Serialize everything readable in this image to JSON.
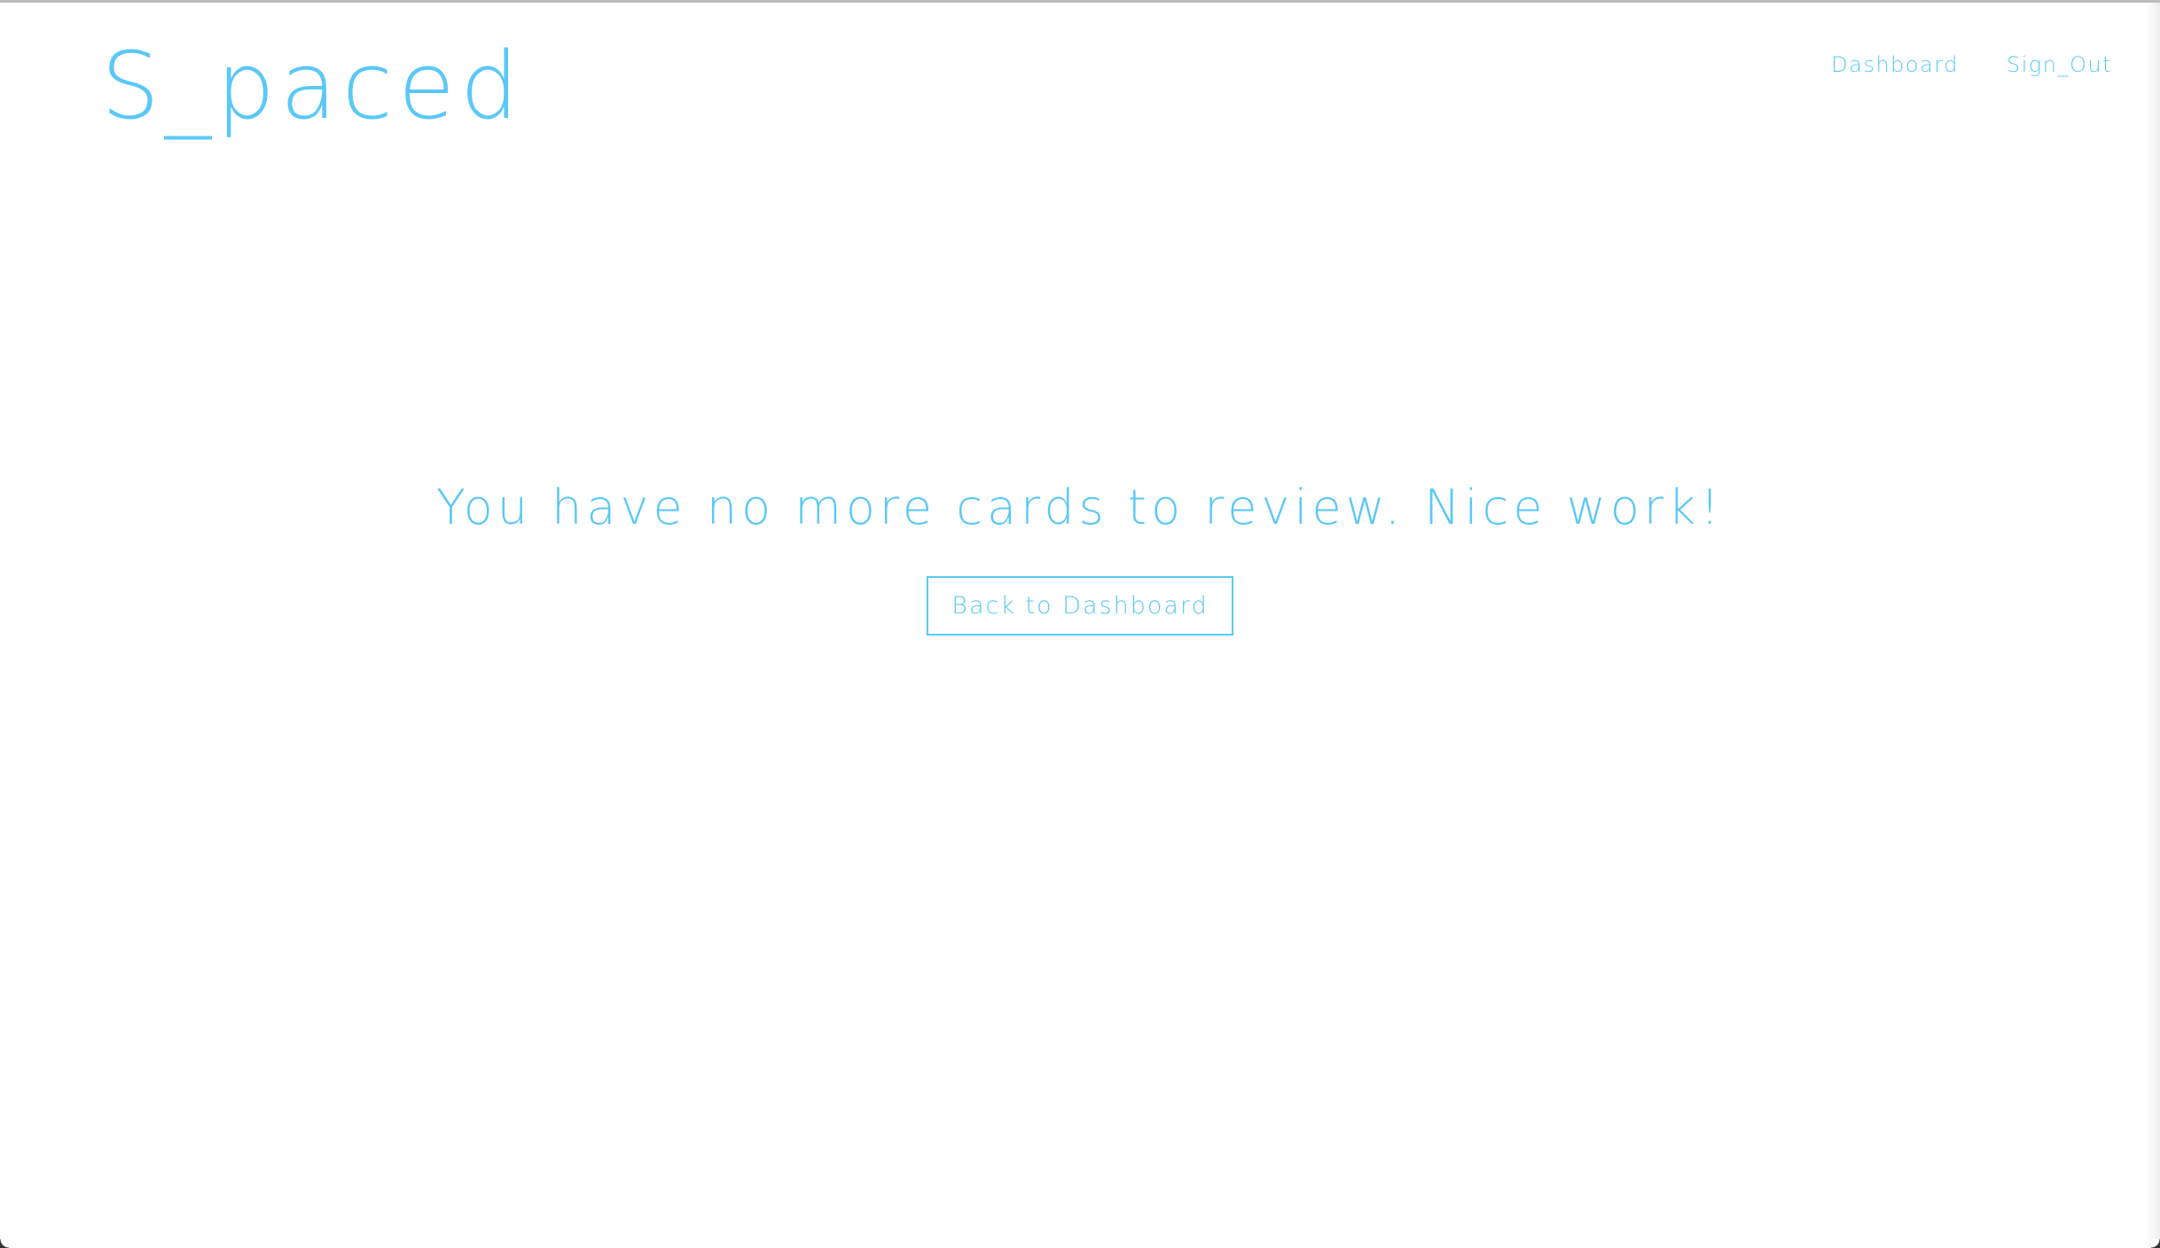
{
  "brand": {
    "logo_text": "S_paced",
    "color": "#5ac8f7"
  },
  "nav": {
    "items": [
      {
        "label": "Dashboard"
      },
      {
        "label": "Sign_Out"
      }
    ]
  },
  "main": {
    "message": "You have no more cards to review. Nice work!",
    "back_button_label": "Back to Dashboard"
  }
}
